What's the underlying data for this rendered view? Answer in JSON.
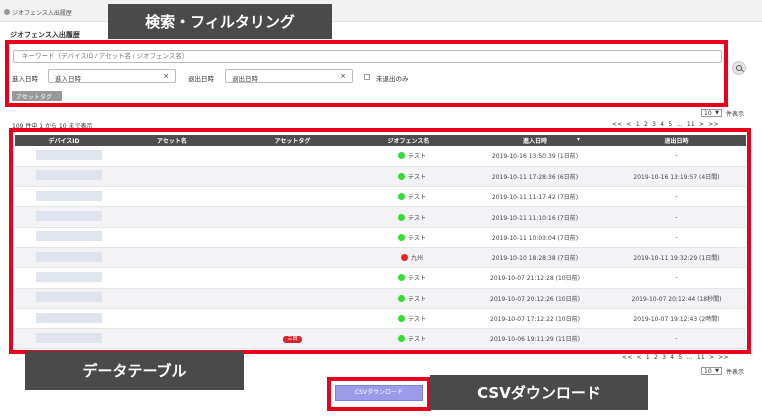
{
  "breadcrumb": "ジオフェンス入出履歴",
  "page_title": "ジオフェンス入出履歴",
  "callouts": {
    "filter": "検索・フィルタリング",
    "table": "データテーブル",
    "csv": "CSVダウンロード"
  },
  "filter": {
    "keyword_placeholder": "キーワード（デバイスID / アセット名 / ジオフェンス名）",
    "entry_label": "進入日時",
    "entry_placeholder": "進入日時",
    "exit_label": "退出日時",
    "exit_placeholder": "退出日時",
    "clear_glyph": "×",
    "not_exited_label": "未退出のみ",
    "asset_tag_button": "アセットタグ"
  },
  "pagination": {
    "per_page": "10",
    "per_page_suffix": "件表示",
    "range_text": "109 件中 1 から 10 まで表示",
    "pages": "<< < 1 2 3 4 5 … 11 > >>"
  },
  "table": {
    "columns": [
      "デバイスID",
      "アセット名",
      "アセットタグ",
      "ジオフェンス名",
      "進入日時",
      "退出日時"
    ],
    "rows": [
      {
        "geofence": "テスト",
        "status_color": "#33dd33",
        "tag": "",
        "entry": "2019-10-16 13:50:39 (1日前)",
        "exit": "-"
      },
      {
        "geofence": "テスト",
        "status_color": "#33dd33",
        "tag": "",
        "entry": "2019-10-11 17:28:36 (6日前)",
        "exit": "2019-10-16 13:19:57 (4日間)"
      },
      {
        "geofence": "テスト",
        "status_color": "#33dd33",
        "tag": "",
        "entry": "2019-10-11 11:17:42 (7日前)",
        "exit": "-"
      },
      {
        "geofence": "テスト",
        "status_color": "#33dd33",
        "tag": "",
        "entry": "2019-10-11 11:10:16 (7日前)",
        "exit": "-"
      },
      {
        "geofence": "テスト",
        "status_color": "#33dd33",
        "tag": "",
        "entry": "2019-10-11 10:03:04 (7日前)",
        "exit": "-"
      },
      {
        "geofence": "九州",
        "status_color": "#ee2222",
        "tag": "",
        "entry": "2019-10-10 18:28:38 (7日前)",
        "exit": "2019-10-11 19:32:29 (1日間)"
      },
      {
        "geofence": "テスト",
        "status_color": "#33dd33",
        "tag": "",
        "entry": "2019-10-07 21:12:28 (10日前)",
        "exit": "-"
      },
      {
        "geofence": "テスト",
        "status_color": "#33dd33",
        "tag": "",
        "entry": "2019-10-07 20:12:26 (10日前)",
        "exit": "2019-10-07 20:12:44 (18秒間)"
      },
      {
        "geofence": "テスト",
        "status_color": "#33dd33",
        "tag": "",
        "entry": "2019-10-07 17:12:22 (10日前)",
        "exit": "2019-10-07 19:12:43 (2時間)"
      },
      {
        "geofence": "テスト",
        "status_color": "#33dd33",
        "tag": "三田",
        "entry": "2019-10-06 19:11:29 (11日前)",
        "exit": "-"
      }
    ]
  },
  "csv_button": "CSVダウンロード",
  "colors": {
    "highlight": "#e8001c",
    "header_bg": "#4d4d4d",
    "button": "#9b9bea"
  }
}
